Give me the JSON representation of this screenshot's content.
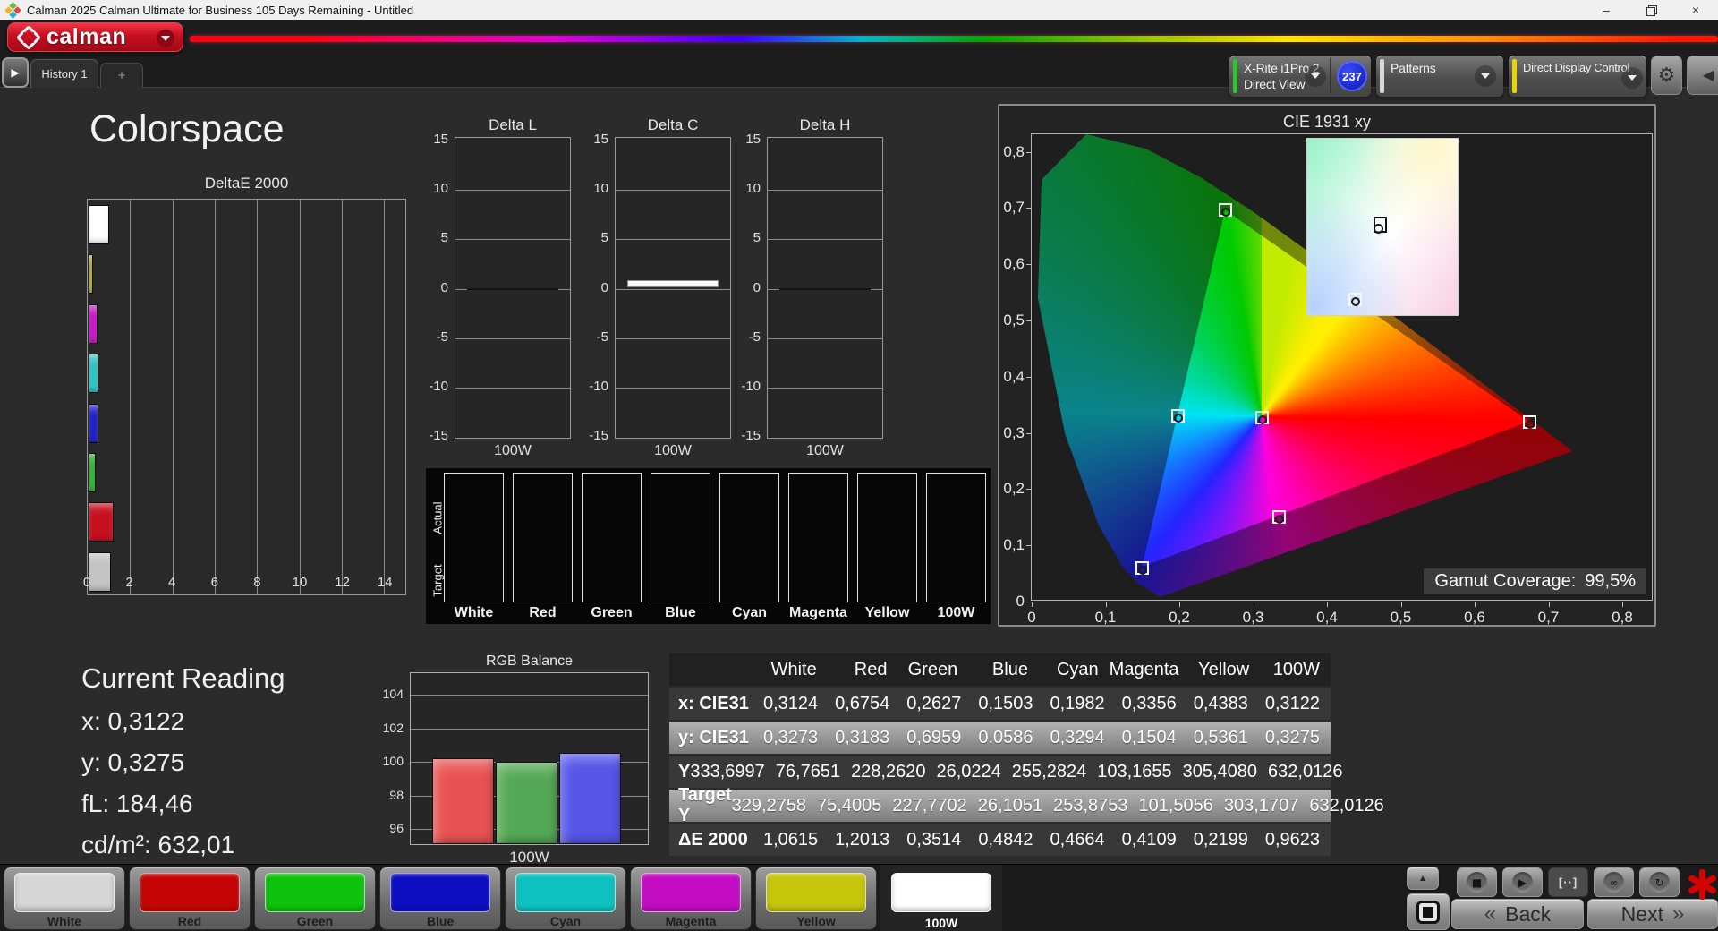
{
  "titlebar": {
    "title": "Calman 2025 Calman Ultimate for Business 105 Days Remaining  - Untitled",
    "minimize": "–",
    "close": "×"
  },
  "header": {
    "logo_text": "calman",
    "tab_arrow": "▶",
    "history_tab": "History 1",
    "add_tab": "+",
    "meter": {
      "line1": "X-Rite i1Pro 2",
      "line2": "Direct View",
      "accent": "#2ec52e",
      "badge": "237"
    },
    "patterns": {
      "label": "Patterns",
      "accent": "#d8d8d8"
    },
    "display_control": {
      "label": "Direct Display Control",
      "accent": "#e8d400"
    },
    "gear": "⚙",
    "collapse_right": "◀"
  },
  "page_title": "Colorspace",
  "current_reading": {
    "title": "Current Reading",
    "lines": [
      "x: 0,3122",
      "y: 0,3275",
      "fL: 184,46",
      "cd/m²: 632,01"
    ]
  },
  "chart_data": [
    {
      "id": "deltae2000",
      "type": "bar",
      "orientation": "horizontal",
      "title": "DeltaE 2000",
      "xlim": [
        0,
        15
      ],
      "xticks": [
        0,
        2,
        4,
        6,
        8,
        10,
        12,
        14
      ],
      "categories": [
        "100W",
        "Yellow",
        "Magenta",
        "Cyan",
        "Blue",
        "Green",
        "Red",
        "White"
      ],
      "values": [
        0.9623,
        0.2199,
        0.4109,
        0.4664,
        0.4842,
        0.3514,
        1.2013,
        1.0615
      ],
      "colors": [
        "#ffffff",
        "#b1a928",
        "#c714c7",
        "#2cc4c4",
        "#1d1dc4",
        "#2eb02e",
        "#c6101f",
        "#c4c4c4"
      ]
    },
    {
      "id": "delta_lch",
      "type": "bar",
      "titles": [
        "Delta L",
        "Delta C",
        "Delta H"
      ],
      "ylim": [
        -15,
        15
      ],
      "yticks": [
        15,
        10,
        5,
        0,
        -5,
        -10,
        -15
      ],
      "xlabel": "100W",
      "values": [
        0.05,
        0.7,
        0.05
      ]
    },
    {
      "id": "rgb_balance",
      "type": "bar",
      "title": "RGB Balance",
      "xlabel": "100W",
      "ylim": [
        95,
        105.3
      ],
      "yticks": [
        104,
        102,
        100,
        98,
        96
      ],
      "categories": [
        "Red",
        "Green",
        "Blue"
      ],
      "values": [
        100.1,
        99.9,
        100.45
      ],
      "colors": [
        "#e85252",
        "#55a855",
        "#5555e8"
      ]
    },
    {
      "id": "cie1931",
      "type": "scatter",
      "title": "CIE 1931 xy",
      "xlim": [
        0,
        0.84
      ],
      "ylim": [
        0,
        0.83
      ],
      "xticks": [
        "0",
        "0,1",
        "0,2",
        "0,3",
        "0,4",
        "0,5",
        "0,6",
        "0,7",
        "0,8"
      ],
      "yticks": [
        "0,8",
        "0,7",
        "0,6",
        "0,5",
        "0,4",
        "0,3",
        "0,2",
        "0,1",
        "0"
      ],
      "points": [
        {
          "name": "White",
          "x": 0.3124,
          "y": 0.3273
        },
        {
          "name": "Red",
          "x": 0.6754,
          "y": 0.3183
        },
        {
          "name": "Green",
          "x": 0.2627,
          "y": 0.6959
        },
        {
          "name": "Blue",
          "x": 0.1503,
          "y": 0.0586
        },
        {
          "name": "Cyan",
          "x": 0.1982,
          "y": 0.3294
        },
        {
          "name": "Magenta",
          "x": 0.3356,
          "y": 0.1504
        },
        {
          "name": "Yellow",
          "x": 0.4383,
          "y": 0.5361
        }
      ],
      "gamut_label": "Gamut Coverage:",
      "gamut_value": "99,5%"
    }
  ],
  "swatch_strip": {
    "row_labels": [
      "Actual",
      "Target"
    ],
    "columns": [
      {
        "label": "White",
        "actual": "#c4c4c4",
        "target": "#c0c0c0"
      },
      {
        "label": "Red",
        "actual": "#cc1126",
        "target": "#c61023"
      },
      {
        "label": "Green",
        "actual": "#17b43c",
        "target": "#1bb347"
      },
      {
        "label": "Blue",
        "actual": "#1d12b8",
        "target": "#1b10b0"
      },
      {
        "label": "Cyan",
        "actual": "#16bec9",
        "target": "#25c3c9"
      },
      {
        "label": "Magenta",
        "actual": "#ca13cb",
        "target": "#c716c7"
      },
      {
        "label": "Yellow",
        "actual": "#c6c61c",
        "target": "#c2c219"
      },
      {
        "label": "100W",
        "actual": "#ffffff",
        "target": "#fdfdfd"
      }
    ]
  },
  "table": {
    "headers": [
      "",
      "White",
      "Red",
      "Green",
      "Blue",
      "Cyan",
      "Magenta",
      "Yellow",
      "100W"
    ],
    "rows": [
      {
        "label": "x: CIE31",
        "highlight": false,
        "values": [
          "0,3124",
          "0,6754",
          "0,2627",
          "0,1503",
          "0,1982",
          "0,3356",
          "0,4383",
          "0,3122"
        ]
      },
      {
        "label": "y: CIE31",
        "highlight": true,
        "values": [
          "0,3273",
          "0,3183",
          "0,6959",
          "0,0586",
          "0,3294",
          "0,1504",
          "0,5361",
          "0,3275"
        ]
      },
      {
        "label": "Y",
        "highlight": false,
        "values": [
          "333,6997",
          "76,7651",
          "228,2620",
          "26,0224",
          "255,2824",
          "103,1655",
          "305,4080",
          "632,0126"
        ]
      },
      {
        "label": "Target Y",
        "highlight": true,
        "values": [
          "329,2758",
          "75,4005",
          "227,7702",
          "26,1051",
          "253,8753",
          "101,5056",
          "303,1707",
          "632,0126"
        ]
      },
      {
        "label": "ΔE 2000",
        "highlight": false,
        "values": [
          "1,0615",
          "1,2013",
          "0,3514",
          "0,4842",
          "0,4664",
          "0,4109",
          "0,2199",
          "0,9623"
        ]
      }
    ]
  },
  "bottom_bar": {
    "buttons": [
      {
        "label": "White",
        "color": "#d6d6d6",
        "selected": false
      },
      {
        "label": "Red",
        "color": "#c50505",
        "selected": false
      },
      {
        "label": "Green",
        "color": "#0ec20e",
        "selected": false
      },
      {
        "label": "Blue",
        "color": "#0d0dc2",
        "selected": false
      },
      {
        "label": "Cyan",
        "color": "#0fc2c2",
        "selected": false
      },
      {
        "label": "Magenta",
        "color": "#c20dc2",
        "selected": false
      },
      {
        "label": "Yellow",
        "color": "#c6c60d",
        "selected": false
      },
      {
        "label": "100W",
        "color": "#ffffff",
        "selected": true
      }
    ],
    "transport": {
      "collapse": "▲",
      "stop": "■",
      "play": "▶",
      "range": "[··]",
      "loop": "∞",
      "refresh": "↻"
    },
    "back": "Back",
    "next": "Next",
    "back_chevron": "«",
    "next_chevron": "»"
  }
}
